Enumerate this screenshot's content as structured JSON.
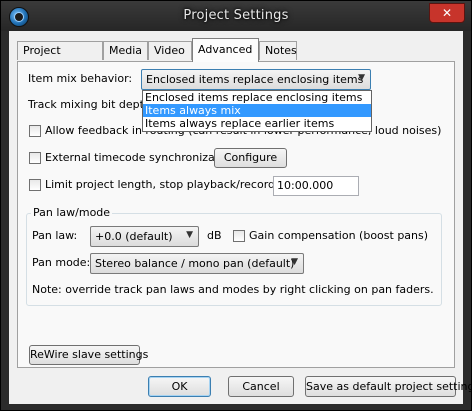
{
  "window": {
    "title": "Project Settings",
    "close_label": "✕",
    "app_icon": "reaper-app-icon"
  },
  "tabs": [
    {
      "label": "Project Settings",
      "active": false
    },
    {
      "label": "Media",
      "active": false
    },
    {
      "label": "Video",
      "active": false
    },
    {
      "label": "Advanced",
      "active": true
    },
    {
      "label": "Notes",
      "active": false
    }
  ],
  "advanced": {
    "item_mix_label": "Item mix behavior:",
    "item_mix_value": "Enclosed items replace enclosing items",
    "item_mix_options": [
      "Enclosed items replace enclosing items",
      "Items always mix",
      "Items always replace earlier items"
    ],
    "item_mix_highlighted": "Items always mix",
    "track_bitdepth_label": "Track mixing bit depth:",
    "allow_feedback_label": "Allow feedback in routing (can result in lower performance, loud noises)",
    "ext_timecode_label": "External timecode synchronization",
    "configure_label": "Configure",
    "limit_length_label": "Limit project length, stop playback/recording at:",
    "limit_length_value": "10:00.000",
    "panlaw_group_title": "Pan law/mode",
    "panlaw_label": "Pan law:",
    "panlaw_value": "+0.0 (default)",
    "db_label": "dB",
    "gain_comp_label": "Gain compensation (boost pans)",
    "panmode_label": "Pan mode:",
    "panmode_value": "Stereo balance / mono pan (default)",
    "pan_note": "Note: override track pan laws and modes by right clicking on pan faders.",
    "rewire_label": "ReWire slave settings"
  },
  "footer": {
    "ok_label": "OK",
    "cancel_label": "Cancel",
    "save_default_label": "Save as default project settings"
  },
  "colors": {
    "selection": "#3399ff",
    "close_button": "#c7342b"
  }
}
